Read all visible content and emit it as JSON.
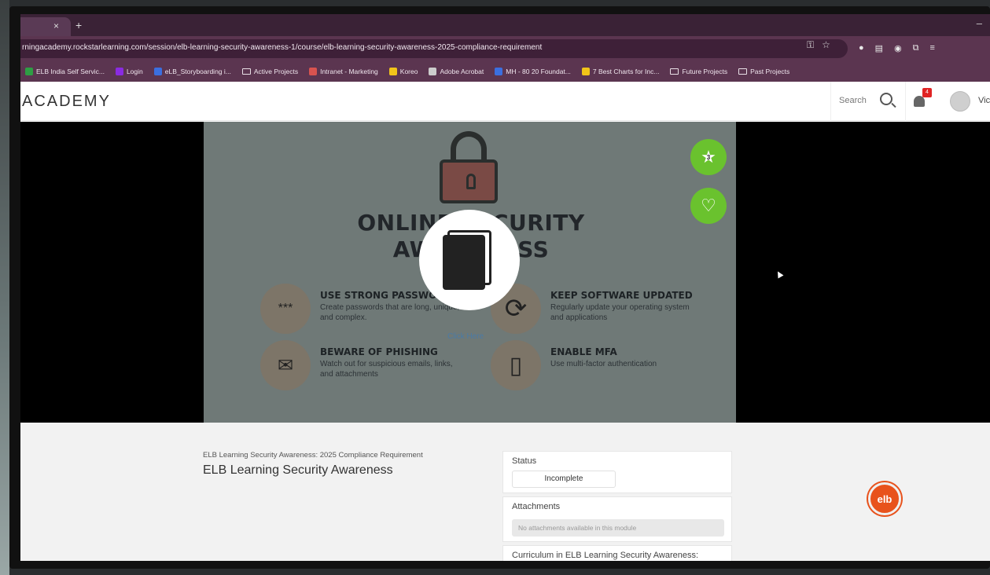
{
  "browser": {
    "tab_close": "×",
    "tab_new": "+",
    "minimize": "–",
    "url": "rningacademy.rockstarlearning.com/session/elb-learning-security-awareness-1/course/elb-learning-security-awareness-2025-compliance-requirement",
    "bookmarks": [
      {
        "label": "ELB India Self Servic...",
        "color": "#2e9e44",
        "type": "icon"
      },
      {
        "label": "Login",
        "color": "#8a2be2",
        "type": "icon"
      },
      {
        "label": "eLB_Storyboarding i...",
        "color": "#3b6fe0",
        "type": "icon"
      },
      {
        "label": "Active Projects",
        "type": "folder"
      },
      {
        "label": "Intranet - Marketing",
        "color": "#d9534f",
        "type": "icon"
      },
      {
        "label": "Koreo",
        "color": "#f0c419",
        "type": "icon"
      },
      {
        "label": "Adobe Acrobat",
        "color": "#cccccc",
        "type": "icon"
      },
      {
        "label": "MH - 80 20 Foundat...",
        "color": "#3b6fe0",
        "type": "icon"
      },
      {
        "label": "7 Best Charts for Inc...",
        "color": "#f0c419",
        "type": "icon"
      },
      {
        "label": "Future Projects",
        "type": "folder"
      },
      {
        "label": "Past Projects",
        "type": "folder"
      }
    ]
  },
  "header": {
    "logo": "ACADEMY",
    "search_label": "Search",
    "notification_count": "4",
    "username": "Vic"
  },
  "slide": {
    "title_line1": "ONLINE SECURITY",
    "title_line2": "AWARENESS",
    "tips": [
      {
        "icon": "password-icon",
        "glyph": "***",
        "heading": "USE STRONG PASSWORDS",
        "body": "Create passwords that are long, unique, and complex."
      },
      {
        "icon": "refresh-icon",
        "glyph": "⟳",
        "heading": "KEEP SOFTWARE UPDATED",
        "body": "Regularly update your operating system and applications"
      },
      {
        "icon": "phishing-icon",
        "glyph": "✉",
        "heading": "BEWARE OF PHISHING",
        "body": "Watch out for suspicious emails, links, and attachments"
      },
      {
        "icon": "mfa-icon",
        "glyph": "▯",
        "heading": "ENABLE MFA",
        "body": "Use multi-factor authentication"
      }
    ],
    "click_here": "Click Here",
    "star_count": "3"
  },
  "content": {
    "breadcrumb": "ELB Learning Security Awareness: 2025 Compliance Requirement",
    "course_title": "ELB Learning Security Awareness",
    "status_label": "Status",
    "status_value": "Incomplete",
    "attachments_label": "Attachments",
    "attachments_empty": "No attachments available in this module",
    "curriculum_label": "Curriculum in ELB Learning Security Awareness:",
    "elb_button": "elb"
  },
  "colors": {
    "accent_green": "#6ac22e",
    "browser_purple": "#5b3550",
    "elb_orange": "#e8521c"
  }
}
